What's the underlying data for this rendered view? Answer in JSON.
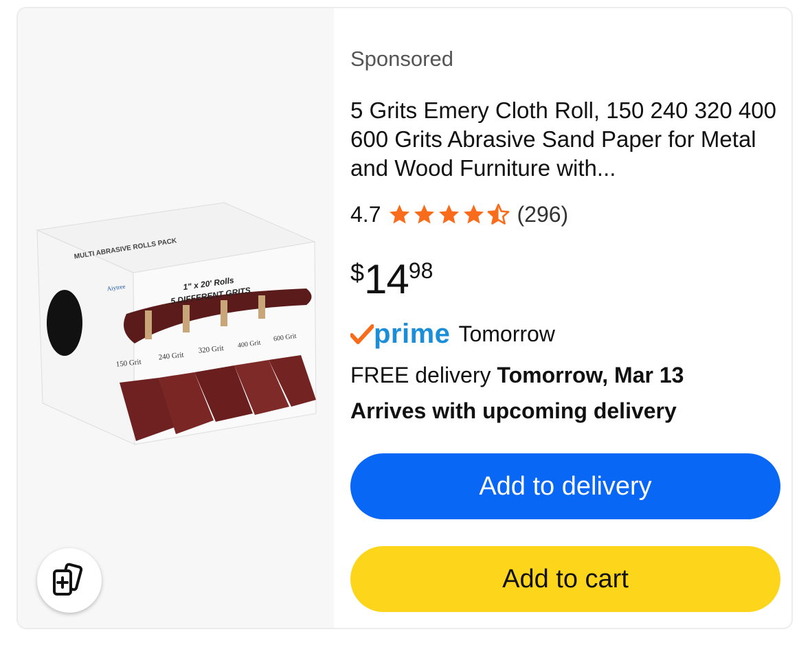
{
  "product": {
    "sponsored_label": "Sponsored",
    "title": "5 Grits Emery Cloth Roll, 150 240 320 400 600 Grits Abrasive Sand Paper for Metal and Wood Furniture with...",
    "rating": "4.7",
    "stars": 4.5,
    "review_count": "(296)",
    "price": {
      "currency": "$",
      "whole": "14",
      "fraction": "98"
    },
    "prime": {
      "logo_text": "prime",
      "label": "Tomorrow"
    },
    "delivery": {
      "prefix": "FREE delivery",
      "date": "Tomorrow, Mar 13"
    },
    "arrives_text": "Arrives with upcoming delivery",
    "image_text": {
      "box_title": "MULTI ABRASIVE ROLLS PACK",
      "brand": "Aiytree",
      "size": "1\" x 20' Rolls",
      "grits_heading": "5 DIFFERENT GRITS",
      "grits": [
        "150 Grit",
        "240 Grit",
        "320 Grit",
        "400 Grit",
        "600 Grit"
      ]
    }
  },
  "buttons": {
    "add_to_delivery": "Add to delivery",
    "add_to_cart": "Add to cart"
  },
  "colors": {
    "star": "#f96c1b",
    "primary_button": "#0867f5",
    "cart_button": "#fdd61c",
    "prime_blue": "#1a8ed8",
    "prime_check": "#f96c1b"
  },
  "icons": {
    "compare": "compare-cards-icon",
    "star": "star-icon"
  }
}
